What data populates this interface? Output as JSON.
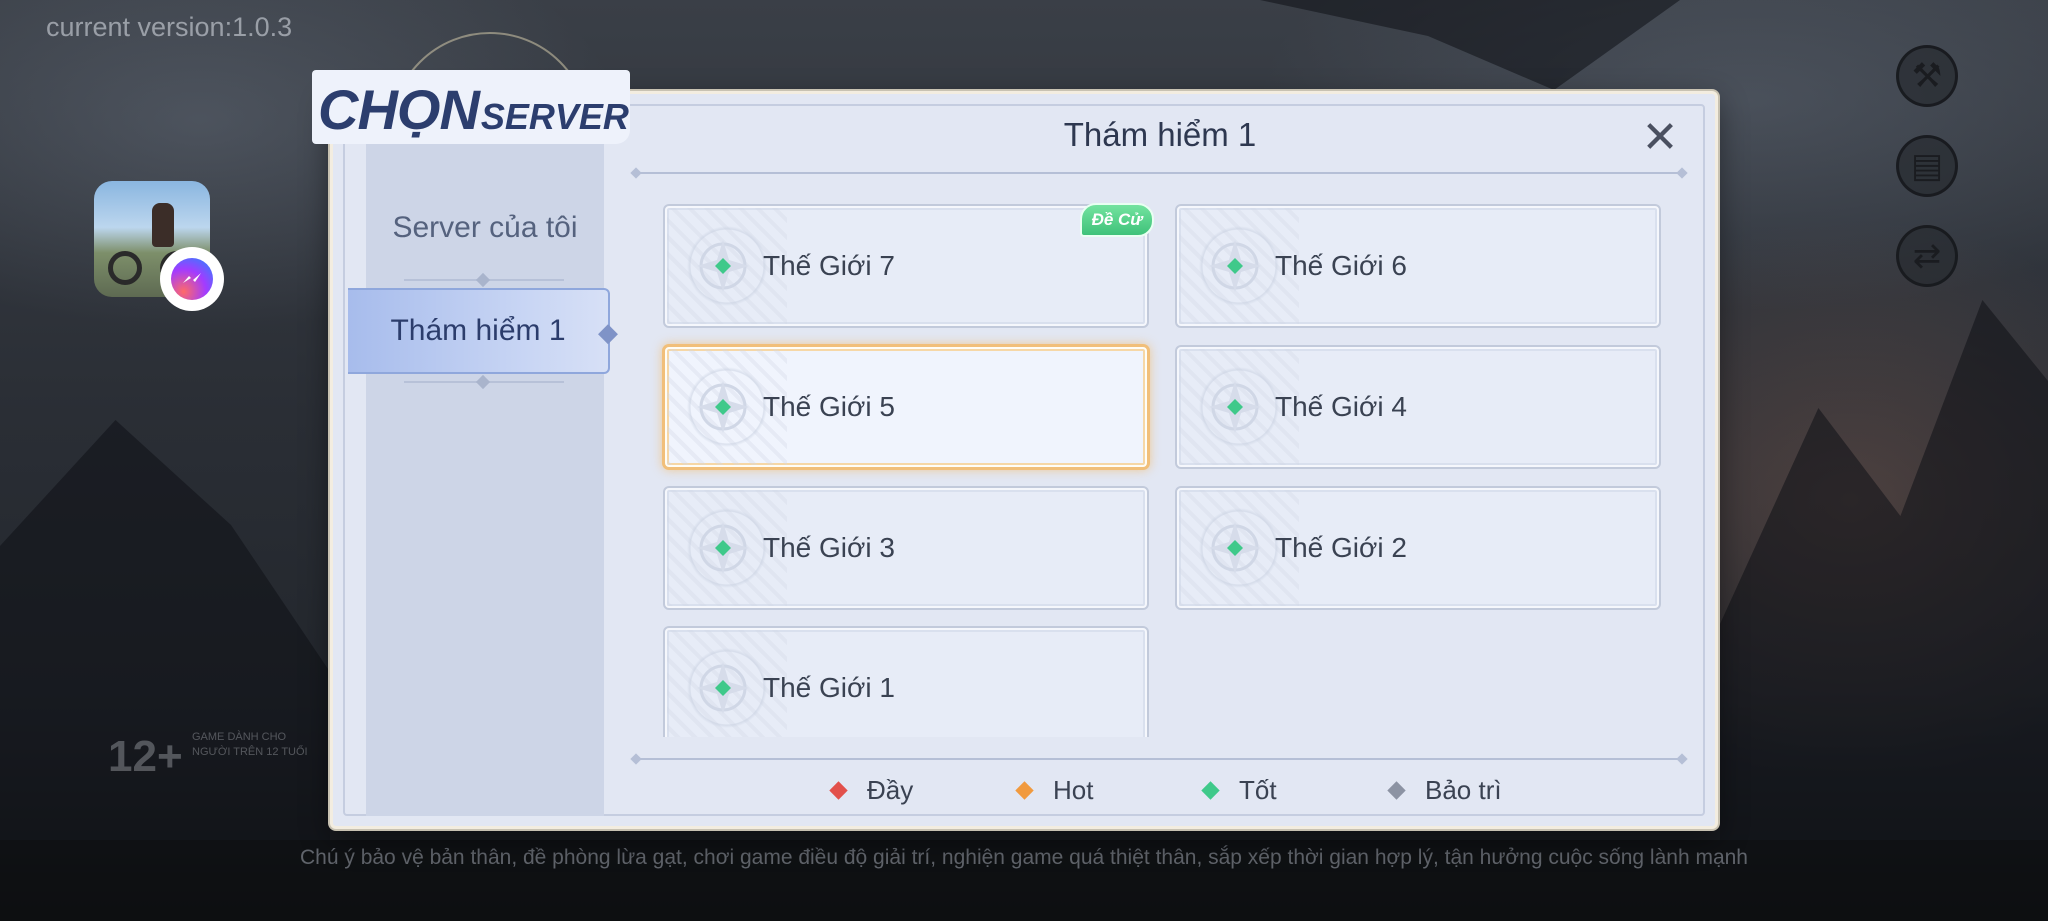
{
  "version_text": "current version:1.0.3",
  "dialog": {
    "title_big": "CHỌN",
    "title_small": "SERVER",
    "header": "Thám hiểm 1",
    "close_glyph": "✕",
    "tabs": [
      {
        "label": "Server của tôi",
        "active": false
      },
      {
        "label": "Thám hiểm 1",
        "active": true
      }
    ],
    "badge": "Đề Cử",
    "servers": [
      {
        "name": "Thế Giới 7",
        "status": "tot",
        "selected": false
      },
      {
        "name": "Thế Giới 6",
        "status": "tot",
        "selected": false
      },
      {
        "name": "Thế Giới 5",
        "status": "tot",
        "selected": true
      },
      {
        "name": "Thế Giới 4",
        "status": "tot",
        "selected": false
      },
      {
        "name": "Thế Giới 3",
        "status": "tot",
        "selected": false
      },
      {
        "name": "Thế Giới 2",
        "status": "tot",
        "selected": false
      },
      {
        "name": "Thế Giới 1",
        "status": "tot",
        "selected": false
      }
    ],
    "legend": [
      {
        "label": "Đầy",
        "color": "#e2504b"
      },
      {
        "label": "Hot",
        "color": "#f19a3e"
      },
      {
        "label": "Tốt",
        "color": "#3fc98a"
      },
      {
        "label": "Bảo trì",
        "color": "#8c93a3"
      }
    ]
  },
  "side_buttons": [
    {
      "icon": "tools-icon",
      "glyph": "⚒"
    },
    {
      "icon": "notice-board-icon",
      "glyph": "▤"
    },
    {
      "icon": "switch-account-icon",
      "glyph": "⇄"
    }
  ],
  "rating": {
    "age": "12+",
    "text": "GAME DÀNH CHO NGƯỜI TRÊN 12 TUỔI"
  },
  "notice": "Chú ý bảo vệ bản thân, đề phòng lừa gạt, chơi game điều độ giải trí, nghiện game quá thiệt thân, sắp xếp thời gian hợp lý, tận hưởng cuộc sống lành mạnh",
  "colors": {
    "accent": "#2c3e6e",
    "status_good": "#3fc98a",
    "selected_glow": "#f1bf7a"
  }
}
